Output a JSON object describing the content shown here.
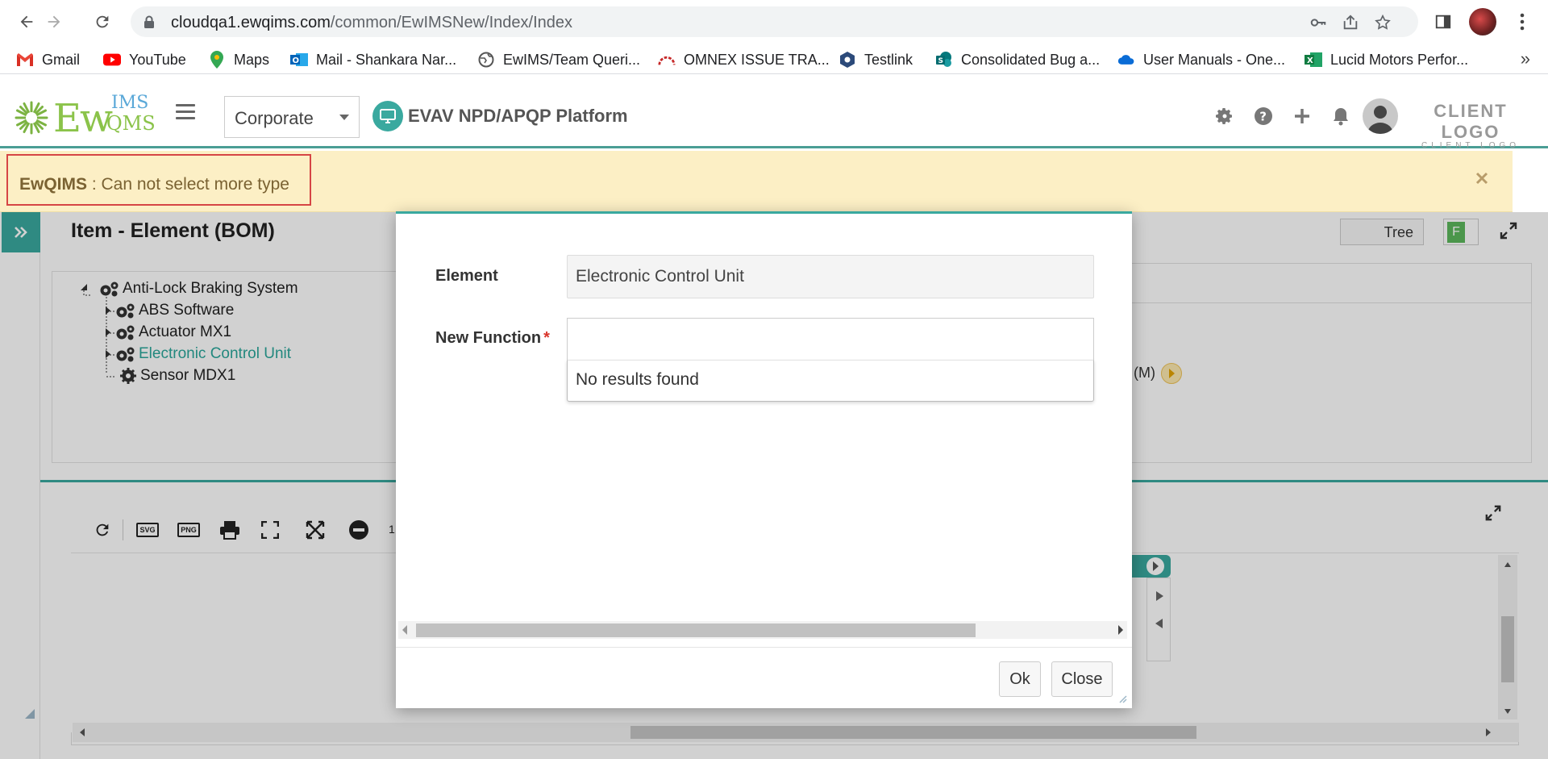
{
  "browser": {
    "url_host": "cloudqa1.ewqims.com",
    "url_path": "/common/EwIMSNew/Index/Index",
    "bookmarks": [
      {
        "label": "Gmail",
        "icon": "gmail-icon"
      },
      {
        "label": "YouTube",
        "icon": "youtube-icon"
      },
      {
        "label": "Maps",
        "icon": "maps-icon"
      },
      {
        "label": "Mail - Shankara Nar...",
        "icon": "outlook-icon"
      },
      {
        "label": "EwIMS/Team Queri...",
        "icon": "globe-icon"
      },
      {
        "label": "OMNEX ISSUE TRA...",
        "icon": "omnex-icon"
      },
      {
        "label": "Testlink",
        "icon": "testlink-icon"
      },
      {
        "label": "Consolidated Bug a...",
        "icon": "sharepoint-icon"
      },
      {
        "label": "User Manuals - One...",
        "icon": "onedrive-icon"
      },
      {
        "label": "Lucid Motors Perfor...",
        "icon": "excel-icon"
      }
    ],
    "more_label": "»"
  },
  "header": {
    "logo_ew": "Ew",
    "logo_ims": "IMS",
    "logo_qms": "QMS",
    "org_select": "Corporate",
    "platform": "EVAV NPD/APQP Platform",
    "client_logo": "CLIENT LOGO",
    "client_logo_sub": "CLIENT LOGO"
  },
  "alert": {
    "source": "EwQIMS",
    "message": " : Can not select more type"
  },
  "page": {
    "title": "Item - Element (BOM)",
    "tree_toggle": "Tree",
    "f_badge": "F",
    "m_label": "(M)",
    "toolbar_icons": [
      "refresh-icon",
      "svg-export-icon",
      "png-export-icon",
      "print-icon",
      "fit-screen-icon",
      "expand-arrows-icon",
      "zoom-out-icon"
    ],
    "toolbar_zoom": "1",
    "tree": [
      {
        "label": "Anti-Lock Braking System",
        "level": 0
      },
      {
        "label": "ABS Software",
        "level": 1
      },
      {
        "label": "Actuator MX1",
        "level": 1
      },
      {
        "label": "Electronic Control Unit",
        "level": 1,
        "selected": true
      },
      {
        "label": "Sensor MDX1",
        "level": 1
      }
    ]
  },
  "modal": {
    "element_label": "Element",
    "element_value": "Electronic Control Unit",
    "function_label": "New Function",
    "function_required": "*",
    "function_value": "",
    "dropdown_message": "No results found",
    "ok_label": "Ok",
    "close_label": "Close"
  },
  "colors": {
    "accent": "#3aa99f",
    "alert_bg": "#fcefc5",
    "alert_border": "#d64545",
    "required": "#d9352b",
    "tree_selected": "#2aa69a"
  }
}
